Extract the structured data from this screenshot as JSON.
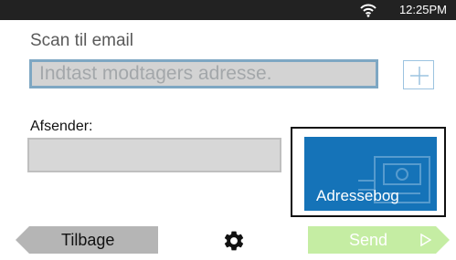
{
  "status_bar": {
    "time": "12:25PM",
    "wifi_icon": "wifi-icon"
  },
  "screen": {
    "title": "Scan til email"
  },
  "recipient": {
    "placeholder": "Indtast modtagers adresse.",
    "value": "",
    "add_icon": "plus-icon"
  },
  "sender": {
    "label": "Afsender:",
    "value": ""
  },
  "address_book": {
    "label": "Adressebog",
    "icon": "address-book-icon"
  },
  "footer": {
    "back_label": "Tilbage",
    "settings_icon": "gear-icon",
    "send_label": "Send",
    "send_icon": "play-arrow-icon"
  },
  "colors": {
    "status_bar": "#222222",
    "accent_blue": "#1573b8",
    "input_border": "#7ea7c3",
    "back_button": "#b5b5b5",
    "send_button": "#c5eda3"
  }
}
